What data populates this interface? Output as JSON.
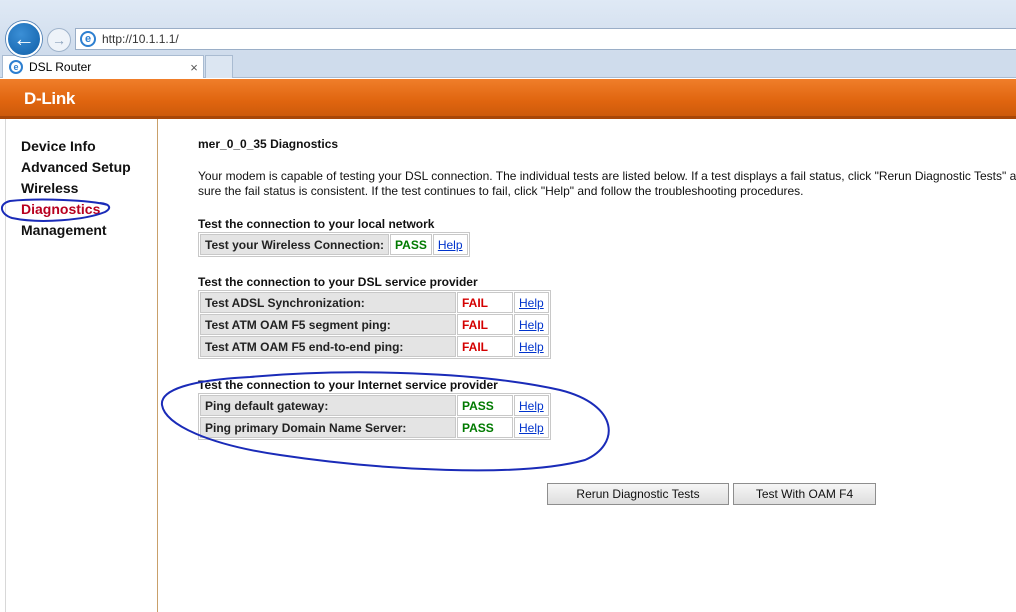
{
  "browser": {
    "url": "http://10.1.1.1/",
    "tab_title": "DSL Router",
    "tab_close": "×",
    "back_glyph": "←",
    "forward_glyph": "→",
    "ie_glyph": "e"
  },
  "brand": {
    "logo_text": "D-Link",
    "accent": "#e0650f"
  },
  "sidebar": {
    "items": [
      {
        "label": "Device Info"
      },
      {
        "label": "Advanced Setup"
      },
      {
        "label": "Wireless"
      },
      {
        "label": "Diagnostics",
        "active": true
      },
      {
        "label": "Management"
      }
    ]
  },
  "page": {
    "title": "mer_0_0_35 Diagnostics",
    "description_line1": "Your modem is capable of testing your DSL connection. The individual tests are listed below. If a test displays a fail status, click \"Rerun Diagnostic Tests\" a",
    "description_line2": "sure the fail status is consistent. If the test continues to fail, click \"Help\" and follow the troubleshooting procedures."
  },
  "sections": {
    "local": {
      "title": "Test the connection to your local network",
      "rows": [
        {
          "label": "Test your Wireless Connection:",
          "status": "PASS",
          "help": "Help"
        }
      ]
    },
    "dsl": {
      "title": "Test the connection to your DSL service provider",
      "rows": [
        {
          "label": "Test ADSL Synchronization:",
          "status": "FAIL",
          "help": "Help"
        },
        {
          "label": "Test ATM OAM F5 segment ping:",
          "status": "FAIL",
          "help": "Help"
        },
        {
          "label": "Test ATM OAM F5 end-to-end ping:",
          "status": "FAIL",
          "help": "Help"
        }
      ]
    },
    "isp": {
      "title": "Test the connection to your Internet service provider",
      "rows": [
        {
          "label": "Ping default gateway:",
          "status": "PASS",
          "help": "Help"
        },
        {
          "label": "Ping primary Domain Name Server:",
          "status": "PASS",
          "help": "Help"
        }
      ]
    }
  },
  "buttons": {
    "rerun": "Rerun Diagnostic Tests",
    "oam_f4": "Test With OAM F4"
  },
  "colors": {
    "pass": "#007a00",
    "fail": "#d40000",
    "annotation": "#1a2bb8"
  }
}
